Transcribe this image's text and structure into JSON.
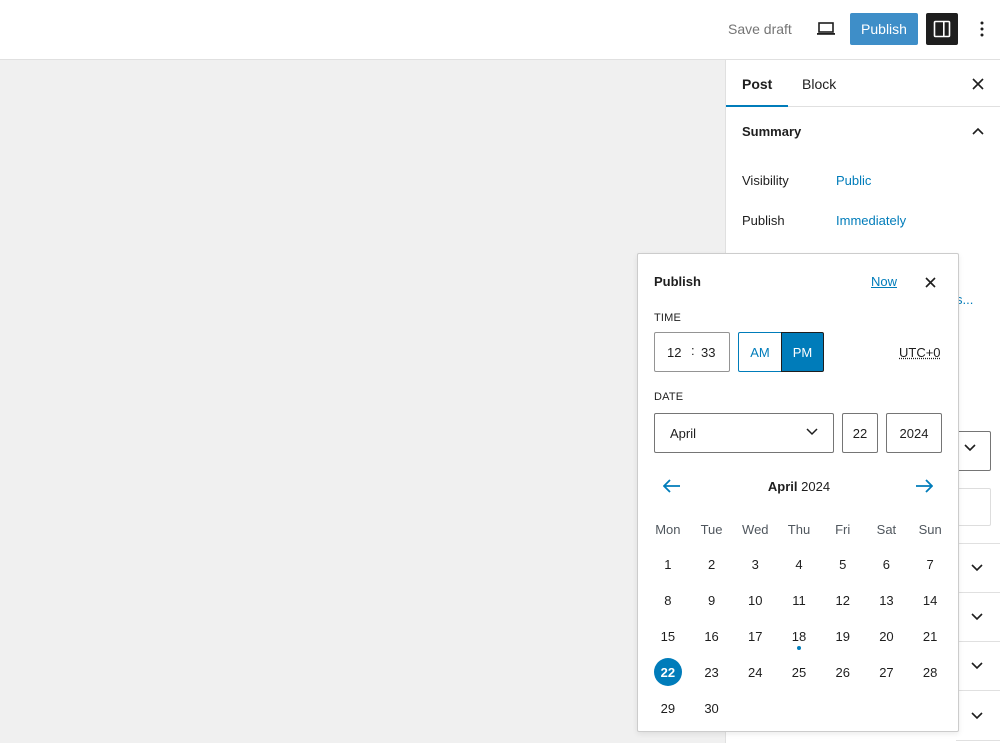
{
  "toolbar": {
    "save_draft_label": "Save draft",
    "publish_label": "Publish",
    "icons": [
      "desktop-preview-icon",
      "sidebar-settings-icon",
      "more-options-icon"
    ]
  },
  "sidebar": {
    "tabs": [
      {
        "label": "Post",
        "active": true
      },
      {
        "label": "Block",
        "active": false
      }
    ],
    "summary_title": "Summary",
    "rows": [
      {
        "label": "Visibility",
        "value": "Public"
      },
      {
        "label": "Publish",
        "value": "Immediately"
      }
    ],
    "partial_link": "s..."
  },
  "popover": {
    "title": "Publish",
    "now_label": "Now",
    "time_label": "TIME",
    "hour": "12",
    "separator": ":",
    "minute": "33",
    "am_label": "AM",
    "pm_label": "PM",
    "selected_period": "PM",
    "timezone": "UTC+0",
    "date_label": "DATE",
    "month": "April",
    "day": "22",
    "year": "2024",
    "calendar_month": "April",
    "calendar_year": "2024",
    "weekdays": [
      "Mon",
      "Tue",
      "Wed",
      "Thu",
      "Fri",
      "Sat",
      "Sun"
    ],
    "weeks": [
      [
        "1",
        "2",
        "3",
        "4",
        "5",
        "6",
        "7"
      ],
      [
        "8",
        "9",
        "10",
        "11",
        "12",
        "13",
        "14"
      ],
      [
        "15",
        "16",
        "17",
        "18",
        "19",
        "20",
        "21"
      ],
      [
        "22",
        "23",
        "24",
        "25",
        "26",
        "27",
        "28"
      ],
      [
        "29",
        "30",
        "",
        "",
        "",
        "",
        ""
      ]
    ],
    "selected_day": "22",
    "today_day": "18"
  },
  "colors": {
    "accent": "#007cba",
    "publish_button": "#3e8ec8",
    "dark": "#1e1e1e"
  }
}
